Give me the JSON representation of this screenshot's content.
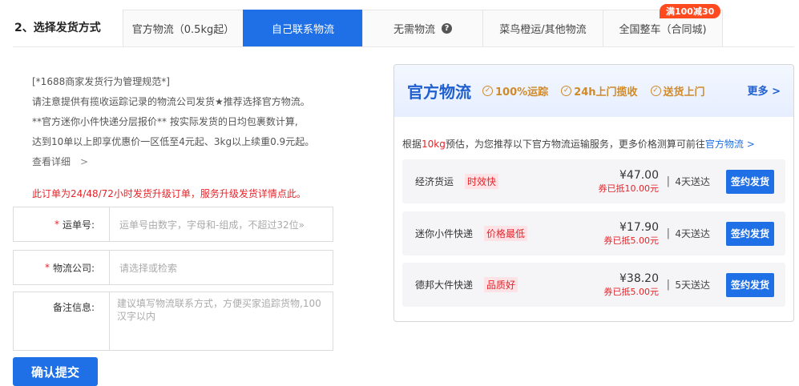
{
  "step_title": "2、选择发货方式",
  "tabs": [
    {
      "label": "官方物流（0.5kg起）"
    },
    {
      "label": "自己联系物流"
    },
    {
      "label": "无需物流"
    },
    {
      "label": "菜鸟橙运/其他物流"
    },
    {
      "label": "全国整车（合同城)"
    }
  ],
  "promo_badge": "满100减30",
  "active_tab_index": 1,
  "notes": {
    "line1": "[*1688商家发货行为管理规范*]",
    "line2": "请注意提供有揽收运踪记录的物流公司发货★推荐选择官方物流。",
    "line3": "**官方迷你小件快递分层报价** 按实际发货的日均包裹数计算,",
    "line4": "达到10单以上即享优惠价一区低至4元起、3kg以上续重0.9元起。",
    "more": "查看详细",
    "more_chevron": ">"
  },
  "warning": "此订单为24/48/72小时发货升级订单，服务升级发货详情点此。",
  "form": {
    "tracking": {
      "label": "运单号:",
      "placeholder": "运单号由数字，字母和-组成，不超过32位»",
      "required_mark": "*"
    },
    "company": {
      "label": "物流公司:",
      "placeholder": "请选择或检索",
      "required_mark": "*"
    },
    "remark": {
      "label": "备注信息:",
      "placeholder": "建议填写物流联系方式，方便买家追踪货物,100汉字以内"
    }
  },
  "submit_label": "确认提交",
  "panel": {
    "title": "官方物流",
    "features": [
      {
        "icon": "check-circle-icon",
        "label": "100%运踪"
      },
      {
        "icon": "check-circle-icon",
        "label": "24h上门揽收"
      },
      {
        "icon": "check-circle-icon",
        "label": "送货上门"
      }
    ],
    "more": "更多",
    "more_chevron": ">",
    "desc_prefix": "根据",
    "desc_weight": "10kg",
    "desc_mid": "预估，为您推荐以下官方物流运输服务，更多价格测算可前往",
    "desc_link": "官方物流",
    "desc_chevron": ">",
    "options": [
      {
        "name": "经济货运",
        "tag": "时效快",
        "price": "¥47.00",
        "coupon": "券已抵10.00元",
        "sep": "|",
        "days": "4天送达",
        "button": "签约发货"
      },
      {
        "name": "迷你小件快递",
        "tag": "价格最低",
        "price": "¥17.90",
        "coupon": "券已抵5.00元",
        "sep": "|",
        "days": "4天送达",
        "button": "签约发货"
      },
      {
        "name": "德邦大件快递",
        "tag": "品质好",
        "price": "¥38.20",
        "coupon": "券已抵5.00元",
        "sep": "|",
        "days": "5天送达",
        "button": "签约发货"
      }
    ]
  },
  "colors": {
    "accent": "#1f6fe6",
    "warning": "#e6242a",
    "feature": "#d08a2a",
    "promo": "#ff4a1f"
  }
}
